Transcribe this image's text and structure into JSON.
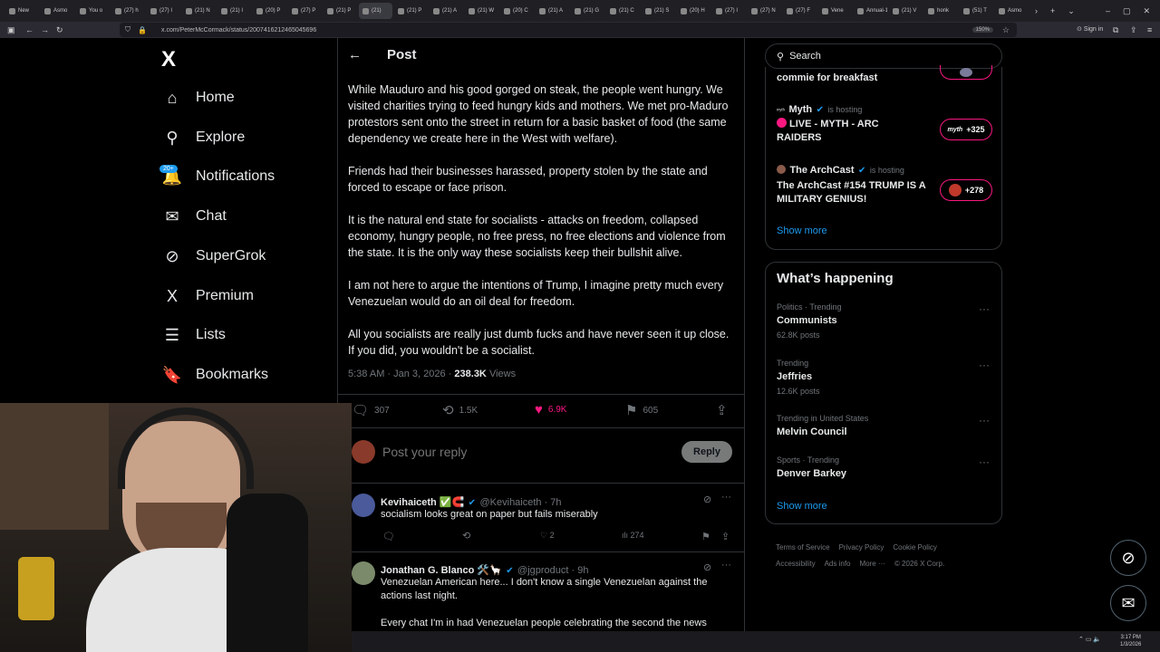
{
  "browser": {
    "tabs": [
      "New",
      "Asmo",
      "You o",
      "(27) h",
      "(27) I",
      "(21) N",
      "(21) I",
      "(20) P",
      "(27) P",
      "(21) P",
      "(21) ",
      "(21) P",
      "(21) A",
      "(21) W",
      "(20) C",
      "(21) A",
      "(21) G",
      "(21) C",
      "(21) S",
      "(20) H",
      "(27) I",
      "(27) N",
      "(27) F",
      "Vene",
      "Annual-1",
      "(21) V",
      "honk",
      "(51) T",
      "Asmo"
    ],
    "active_tab_index": 10,
    "url": "x.com/PeterMcCormack/status/2007416212465045696",
    "zoom": "150%",
    "sign_in": "Sign in"
  },
  "nav": {
    "logo": "X",
    "items": [
      {
        "label": "Home",
        "icon": "home-icon",
        "glyph": "⌂"
      },
      {
        "label": "Explore",
        "icon": "search-icon",
        "glyph": "⚲"
      },
      {
        "label": "Notifications",
        "icon": "bell-icon",
        "glyph": "🔔"
      },
      {
        "label": "Chat",
        "icon": "mail-icon",
        "glyph": "✉"
      },
      {
        "label": "SuperGrok",
        "icon": "grok-icon",
        "glyph": "⊘"
      },
      {
        "label": "Premium",
        "icon": "x-premium-icon",
        "glyph": "X"
      },
      {
        "label": "Lists",
        "icon": "list-icon",
        "glyph": "☰"
      },
      {
        "label": "Bookmarks",
        "icon": "bookmark-icon",
        "glyph": "🔖"
      }
    ],
    "notifications_badge": "20+"
  },
  "post": {
    "header": "Post",
    "paragraphs": [
      "While Mauduro and his good gorged on steak, the people went hungry. We visited charities trying to feed hungry kids and mothers. We met pro-Maduro protestors sent onto the street in return for a basic basket of food (the same dependency we create here in the West with welfare).",
      "Friends had their businesses harassed, property stolen by the state and forced to escape or face prison.",
      "It is the natural end state for socialists - attacks on freedom, collapsed economy, hungry people, no free press, no free elections and violence from the state. It is the only way these socialists keep their bullshit alive.",
      "I am not here to argue the intentions of Trump, I imagine pretty much every Venezuelan would do an oil deal for freedom.",
      "All you socialists are really just dumb fucks and have never seen it up close. If you did, you wouldn't be a socialist."
    ],
    "time": "5:38 AM · Jan 3, 2026 · ",
    "views": "238.3K",
    "views_label": " Views",
    "stats": {
      "replies": "307",
      "reposts": "1.5K",
      "likes": "6.9K",
      "bookmarks": "605"
    },
    "reply_placeholder": "Post your reply",
    "reply_button": "Reply"
  },
  "replies": [
    {
      "name": "Kevihaiceth ✅🧲",
      "handle": "@Kevihaiceth · 7h",
      "text": "socialism looks great on paper but fails miserably",
      "likes": "2",
      "views": "274"
    },
    {
      "name": "Jonathan G. Blanco 🛠️🦙",
      "handle": "@jgproduct · 9h",
      "text": "Venezuelan American here... I don't know a single Venezuelan against the actions last night.",
      "text2": "Every chat I'm in had Venezuelan people celebrating the second the news"
    }
  ],
  "sidebar": {
    "search_placeholder": "Search",
    "live": [
      {
        "title": "commie for breakfast",
        "host": "",
        "count": ""
      },
      {
        "name": "Myth",
        "host": "is hosting",
        "title": "LIVE - MYTH - ARC RAIDERS",
        "count": "+325",
        "pill": "myth"
      },
      {
        "name": "The ArchCast",
        "host": "is hosting",
        "title": "The ArchCast #154 TRUMP IS A MILITARY GENIUS!",
        "count": "+278"
      }
    ],
    "show_more": "Show more",
    "happening_title": "What’s happening",
    "trends": [
      {
        "category": "Politics · Trending",
        "name": "Communists",
        "posts": "62.8K posts"
      },
      {
        "category": "Trending",
        "name": "Jeffries",
        "posts": "12.6K posts"
      },
      {
        "category": "Trending in United States",
        "name": "Melvin Council",
        "posts": ""
      },
      {
        "category": "Sports · Trending",
        "name": "Denver Barkey",
        "posts": ""
      }
    ],
    "show_more2": "Show more",
    "footer": [
      "Terms of Service",
      "Privacy Policy",
      "Cookie Policy",
      "Accessibility",
      "Ads info",
      "More ···",
      "© 2026 X Corp."
    ]
  },
  "taskbar": {
    "time": "3:17 PM",
    "date": "1/3/2026"
  }
}
